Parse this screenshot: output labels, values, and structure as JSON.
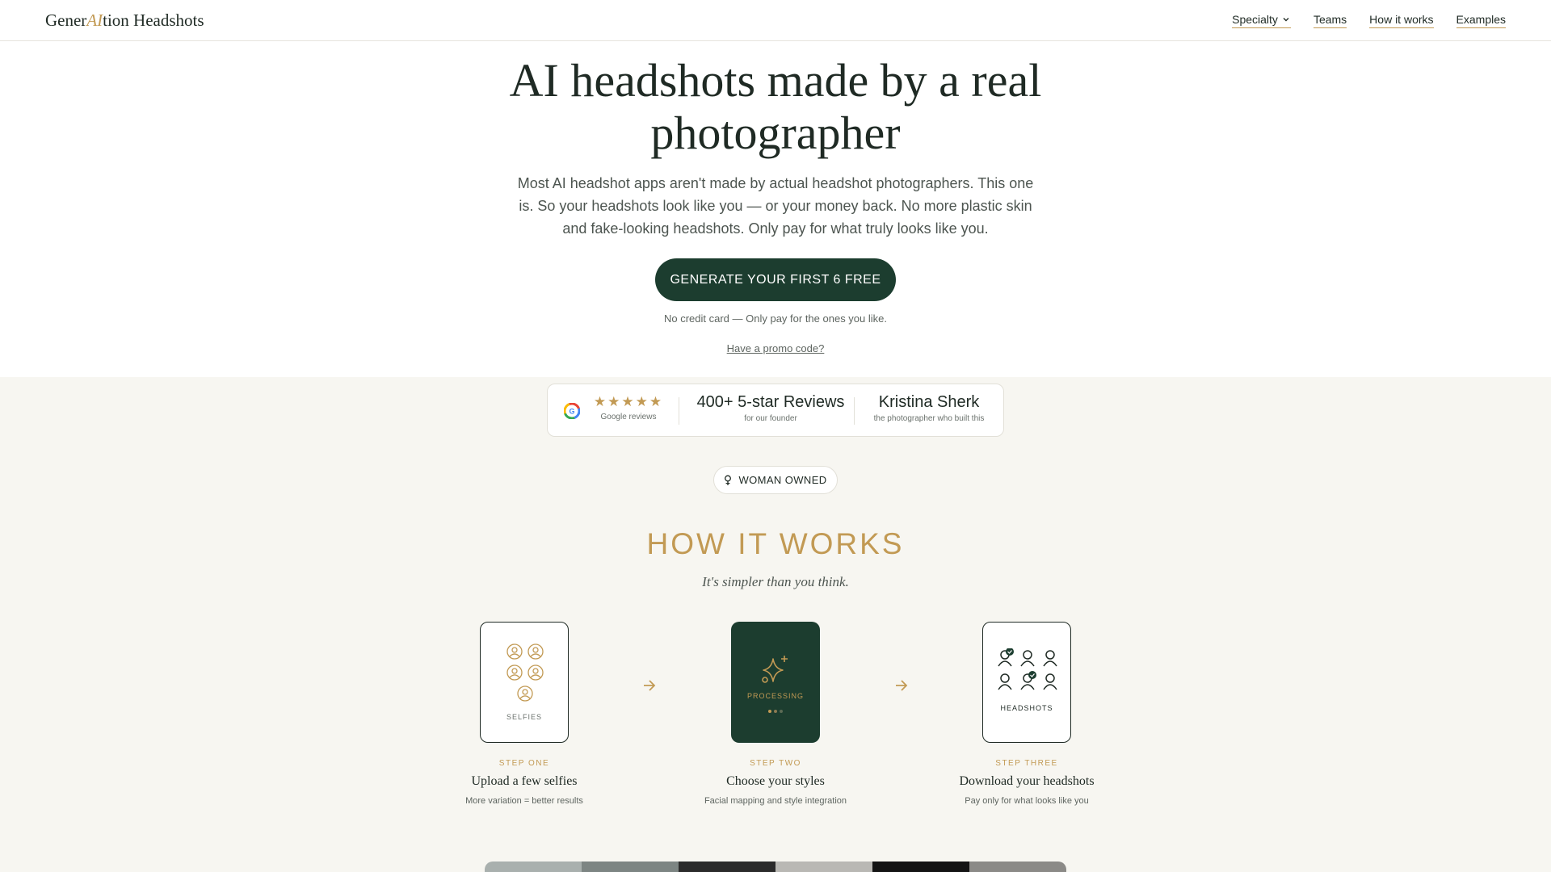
{
  "header": {
    "logo_pre": "Gener",
    "logo_ai": "AI",
    "logo_post": "tion Headshots",
    "nav": [
      {
        "label": "Specialty"
      },
      {
        "label": "Teams"
      },
      {
        "label": "How it works"
      },
      {
        "label": "Examples"
      }
    ]
  },
  "hero": {
    "title": "AI headshots made by a real photographer",
    "subtitle": "Most AI headshot apps aren't made by actual headshot photographers. This one is. So your headshots look like you — or your money back. No more plastic skin and fake-looking headshots. Only pay for what truly looks like you.",
    "cta_label": "GENERATE YOUR FIRST 6 FREE",
    "note": "No credit card — Only pay for the ones you like.",
    "promo_link": "Have a promo code?"
  },
  "reviews": {
    "stars": "★★★★★",
    "rating_out_of_5": 5,
    "google_caption": "Google reviews",
    "count_title": "400+ 5-star Reviews",
    "count_caption": "for our founder",
    "founder_name": "Kristina Sherk",
    "founder_caption": "the photographer who built this"
  },
  "badge": {
    "icon": "female-symbol-icon",
    "label": "WOMAN OWNED"
  },
  "how_it_works": {
    "title": "HOW IT WORKS",
    "subtitle": "It's simpler than you think.",
    "steps": [
      {
        "card_label": "SELFIES",
        "num": "STEP ONE",
        "title": "Upload a few selfies",
        "desc": "More variation = better results"
      },
      {
        "card_label": "PROCESSING",
        "num": "STEP TWO",
        "title": "Choose your styles",
        "desc": "Facial mapping and style integration"
      },
      {
        "card_label": "HEADSHOTS",
        "num": "STEP THREE",
        "title": "Download your headshots",
        "desc": "Pay only for what looks like you"
      }
    ]
  },
  "colors": {
    "brand_green": "#1c3d2f",
    "accent_gold": "#c29a54",
    "page_bg": "#f7f6f1"
  }
}
